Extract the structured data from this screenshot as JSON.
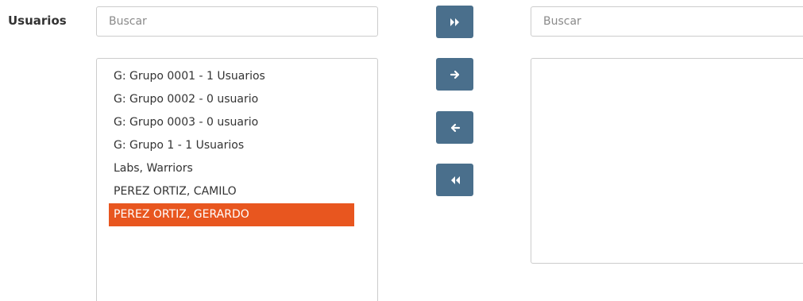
{
  "form": {
    "label": "Usuarios"
  },
  "available": {
    "search_placeholder": "Buscar",
    "items": [
      {
        "label": "G: Grupo 0001 - 1 Usuarios",
        "selected": false
      },
      {
        "label": "G: Grupo 0002 - 0 usuario",
        "selected": false
      },
      {
        "label": "G: Grupo 0003 - 0 usuario",
        "selected": false
      },
      {
        "label": "G: Grupo 1 - 1 Usuarios",
        "selected": false
      },
      {
        "label": "Labs, Warriors",
        "selected": false
      },
      {
        "label": "PEREZ ORTIZ, CAMILO",
        "selected": false
      },
      {
        "label": "PEREZ ORTIZ, GERARDO",
        "selected": true
      }
    ]
  },
  "selected": {
    "search_placeholder": "Buscar",
    "items": []
  },
  "transfer_buttons": {
    "move_all_right_icon": "double-chevron-right-icon",
    "move_right_icon": "arrow-right-icon",
    "move_left_icon": "arrow-left-icon",
    "move_all_left_icon": "double-chevron-left-icon"
  },
  "colors": {
    "button_bg": "#4a6f8c",
    "selected_item_bg": "#e8561f"
  }
}
